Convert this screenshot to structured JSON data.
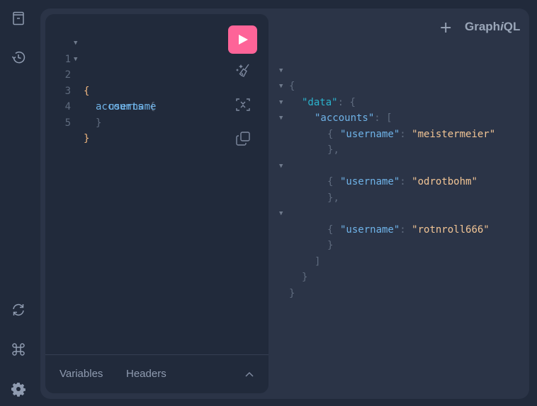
{
  "sidebar": {
    "top": [
      {
        "name": "docs-explorer",
        "icon": "book-icon"
      },
      {
        "name": "history",
        "icon": "history-icon"
      }
    ],
    "bottom": [
      {
        "name": "refetch-schema",
        "icon": "refresh-icon"
      },
      {
        "name": "keyboard-shortcuts",
        "icon": "command-key-icon"
      },
      {
        "name": "settings",
        "icon": "gear-icon"
      }
    ]
  },
  "header": {
    "add_tab_label": "+",
    "logo_prefix": "Graph",
    "logo_italic": "i",
    "logo_suffix": "QL"
  },
  "query_editor": {
    "lines": [
      {
        "number": "1",
        "text": "{",
        "foldable": true
      },
      {
        "number": "2",
        "text": "accounts",
        "brace": "{",
        "foldable": true
      },
      {
        "number": "3",
        "text": "username",
        "foldable": false
      },
      {
        "number": "4",
        "text": "}",
        "foldable": false
      },
      {
        "number": "5",
        "text": "}",
        "foldable": false
      }
    ],
    "fold_glyph": "▼"
  },
  "toolbar": {
    "run": "execute-query",
    "prettify": "prettify-query",
    "merge": "merge-fragments",
    "copy": "copy-query"
  },
  "bottom_tabs": {
    "variables": "Variables",
    "headers": "Headers"
  },
  "response": {
    "open_brace": "{",
    "close_brace": "}",
    "data_key": "\"data\"",
    "accounts_key": "\"accounts\"",
    "colon": ": ",
    "open_bracket": "[",
    "close_bracket": "]",
    "username_key": "\"username\"",
    "items": [
      {
        "username": "\"meistermeier\""
      },
      {
        "username": "\"odrotbohm\""
      },
      {
        "username": "\"rotnroll666\""
      }
    ]
  },
  "colors": {
    "accent": "#fe6498",
    "background": "#212a3b",
    "panel": "#2b3447"
  }
}
